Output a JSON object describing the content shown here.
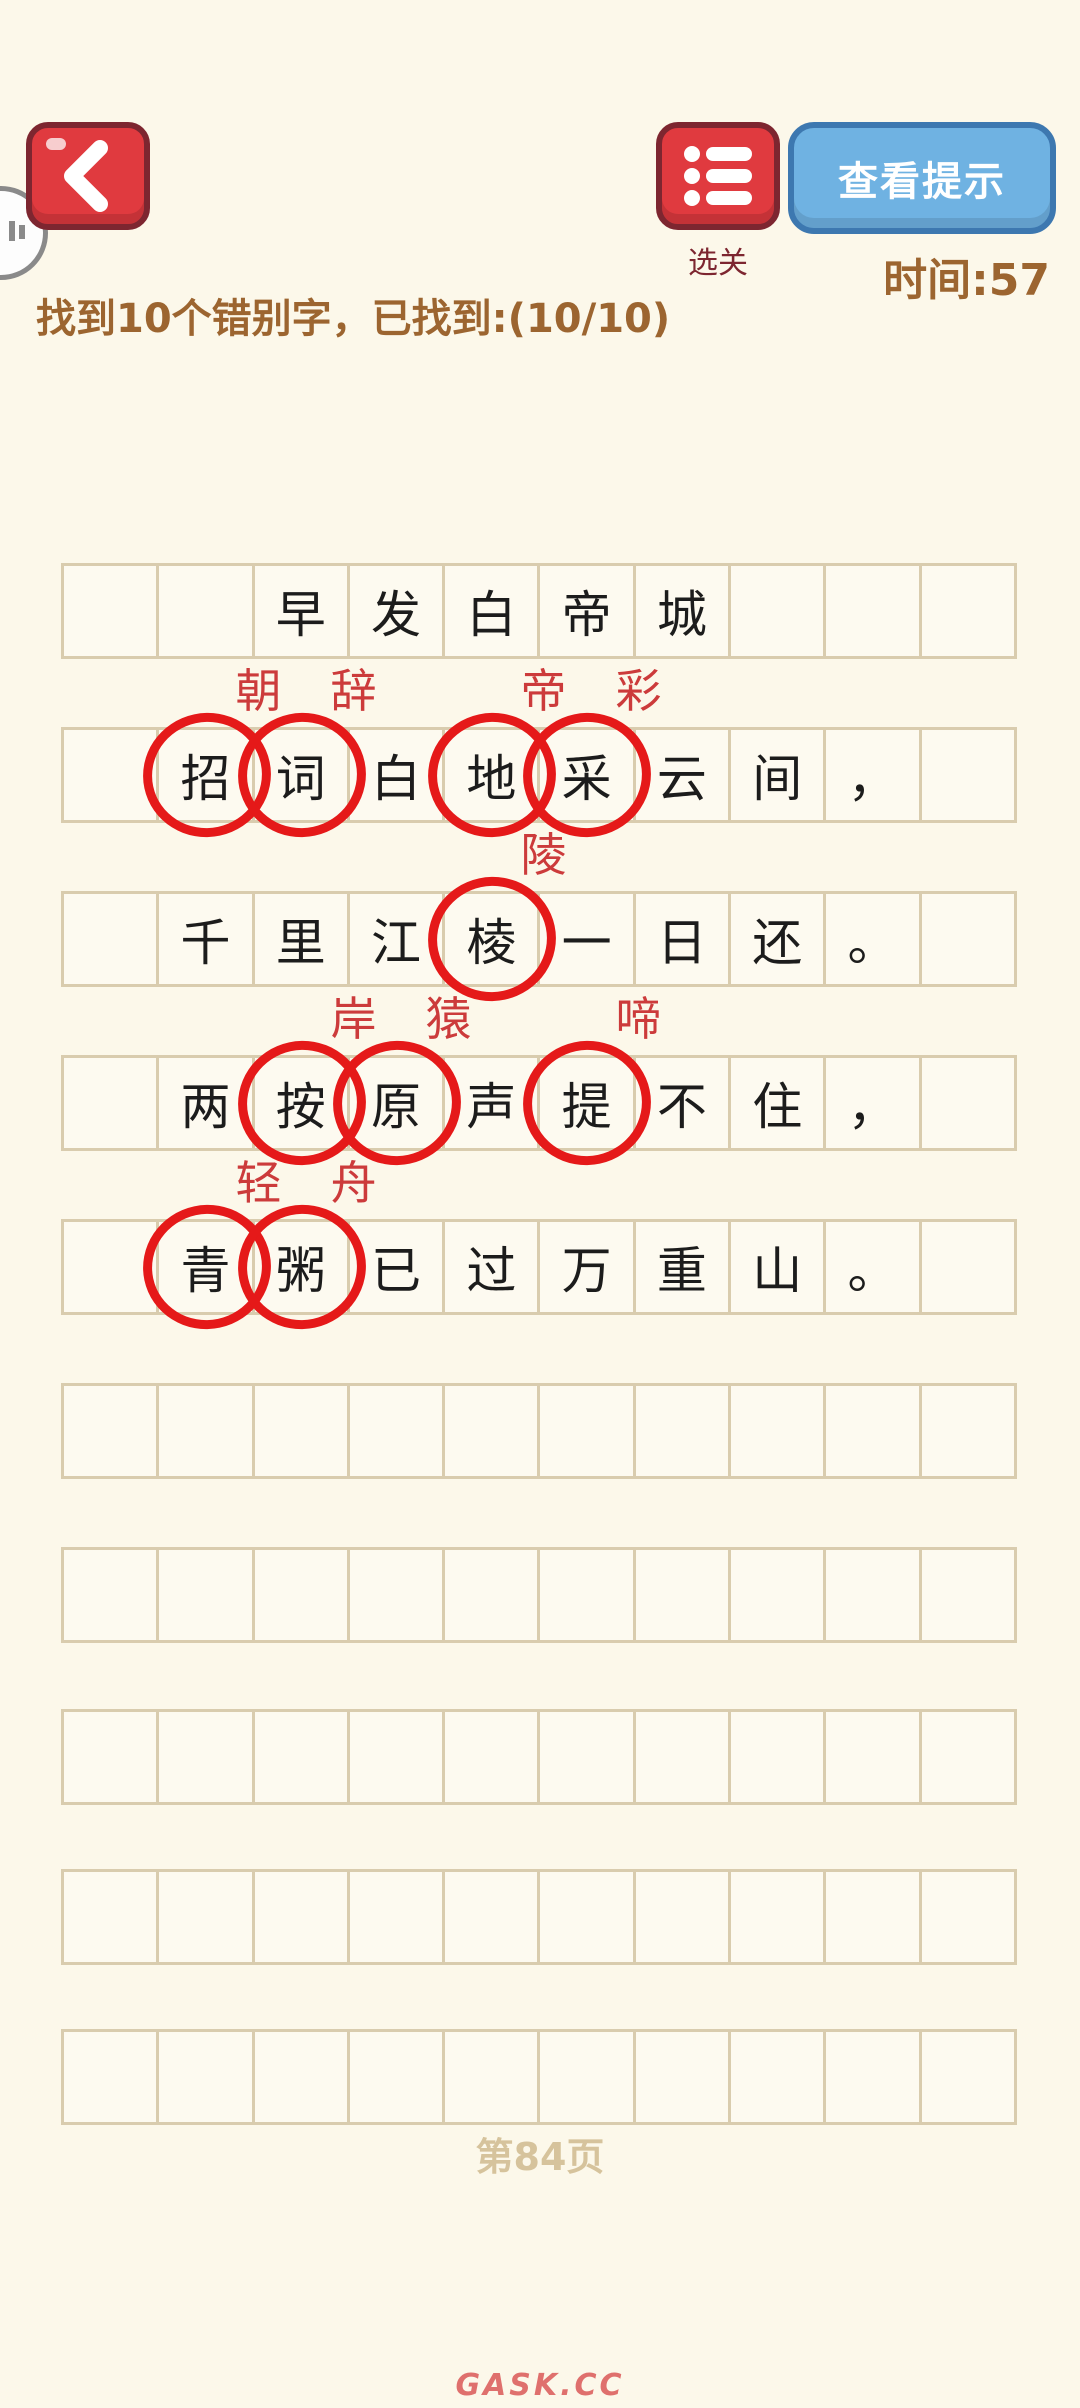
{
  "header": {
    "level_label": "选关",
    "hint_label": "查看提示",
    "timer": "时间:57",
    "task": "找到10个错别字，已找到:(10/10)"
  },
  "poem": {
    "rows": [
      [
        "",
        "",
        "早",
        "发",
        "白",
        "帝",
        "城",
        "",
        "",
        ""
      ],
      [
        "",
        "招",
        "词",
        "白",
        "地",
        "采",
        "云",
        "间",
        "，",
        ""
      ],
      [
        "",
        "千",
        "里",
        "江",
        "棱",
        "一",
        "日",
        "还",
        "。",
        ""
      ],
      [
        "",
        "两",
        "按",
        "原",
        "声",
        "提",
        "不",
        "住",
        "，",
        ""
      ],
      [
        "",
        "青",
        "粥",
        "已",
        "过",
        "万",
        "重",
        "山",
        "。",
        ""
      ],
      [
        "",
        "",
        "",
        "",
        "",
        "",
        "",
        "",
        "",
        ""
      ],
      [
        "",
        "",
        "",
        "",
        "",
        "",
        "",
        "",
        "",
        ""
      ],
      [
        "",
        "",
        "",
        "",
        "",
        "",
        "",
        "",
        "",
        ""
      ],
      [
        "",
        "",
        "",
        "",
        "",
        "",
        "",
        "",
        "",
        ""
      ],
      [
        "",
        "",
        "",
        "",
        "",
        "",
        "",
        "",
        "",
        ""
      ]
    ]
  },
  "corrections": [
    {
      "row": 1,
      "col": 1,
      "wrong": "招",
      "right": "朝"
    },
    {
      "row": 1,
      "col": 2,
      "wrong": "词",
      "right": "辞"
    },
    {
      "row": 1,
      "col": 4,
      "wrong": "地",
      "right": "帝"
    },
    {
      "row": 1,
      "col": 5,
      "wrong": "采",
      "right": "彩"
    },
    {
      "row": 2,
      "col": 4,
      "wrong": "棱",
      "right": "陵"
    },
    {
      "row": 3,
      "col": 2,
      "wrong": "按",
      "right": "岸"
    },
    {
      "row": 3,
      "col": 3,
      "wrong": "原",
      "right": "猿"
    },
    {
      "row": 3,
      "col": 5,
      "wrong": "提",
      "right": "啼"
    },
    {
      "row": 4,
      "col": 1,
      "wrong": "青",
      "right": "轻"
    },
    {
      "row": 4,
      "col": 2,
      "wrong": "粥",
      "right": "舟"
    }
  ],
  "footer": {
    "page": "第84页",
    "watermark": "GASK.CC"
  },
  "colors": {
    "accent_red": "#e03a3f",
    "hint_blue": "#6fb2e2",
    "text_brown": "#9c6530",
    "circle_red": "#e51919"
  },
  "icons": [
    "back-arrow-icon",
    "list-menu-icon",
    "sound-icon"
  ]
}
